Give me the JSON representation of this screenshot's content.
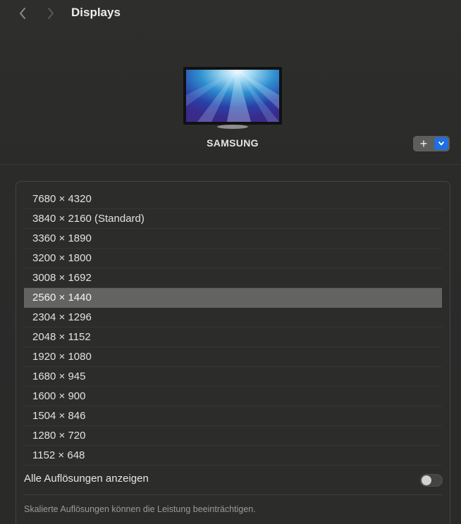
{
  "header": {
    "title": "Displays",
    "back_icon": "chevron-left-icon",
    "forward_icon": "chevron-right-icon"
  },
  "display": {
    "name": "SAMSUNG",
    "add_label": "+",
    "add_menu_icon": "chevron-down-icon"
  },
  "resolutions": {
    "items": [
      {
        "label": "7680 × 4320",
        "selected": false
      },
      {
        "label": "3840 × 2160 (Standard)",
        "selected": false
      },
      {
        "label": "3360 × 1890",
        "selected": false
      },
      {
        "label": "3200 × 1800",
        "selected": false
      },
      {
        "label": "3008 × 1692",
        "selected": false
      },
      {
        "label": "2560 × 1440",
        "selected": true
      },
      {
        "label": "2304 × 1296",
        "selected": false
      },
      {
        "label": "2048 × 1152",
        "selected": false
      },
      {
        "label": "1920 × 1080",
        "selected": false
      },
      {
        "label": "1680 × 945",
        "selected": false
      },
      {
        "label": "1600 × 900",
        "selected": false
      },
      {
        "label": "1504 × 846",
        "selected": false
      },
      {
        "label": "1280 × 720",
        "selected": false
      },
      {
        "label": "1152 × 648",
        "selected": false
      }
    ],
    "show_all_label": "Alle Auflösungen anzeigen",
    "show_all_enabled": false,
    "footnote": "Skalierte Auflösungen können die Leistung beeinträchtigen."
  },
  "colors": {
    "accent": "#1f6fe0",
    "selection": "#636362",
    "background": "#2b2b2a"
  }
}
